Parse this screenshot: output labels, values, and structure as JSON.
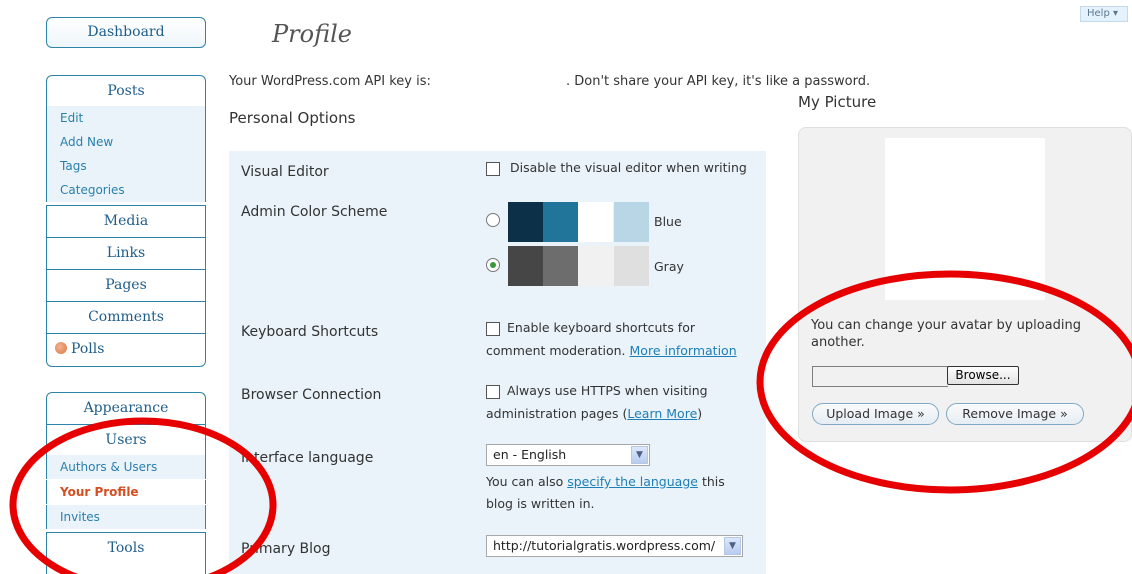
{
  "help_label": "Help",
  "page_title": "Profile",
  "api_key": {
    "prefix": "Your WordPress.com API key is:",
    "suffix": ". Don't share your API key, it's like a password."
  },
  "section_title": "Personal Options",
  "sidebar": {
    "dashboard": "Dashboard",
    "posts": "Posts",
    "posts_sub": [
      "Edit",
      "Add New",
      "Tags",
      "Categories"
    ],
    "media": "Media",
    "links": "Links",
    "pages": "Pages",
    "comments": "Comments",
    "polls": "Polls",
    "appearance": "Appearance",
    "users": "Users",
    "users_sub": [
      "Authors & Users",
      "Your Profile",
      "Invites"
    ],
    "tools": "Tools"
  },
  "options": {
    "visual_editor": {
      "label": "Visual Editor",
      "checkbox": "Disable the visual editor when writing"
    },
    "color_scheme": {
      "label": "Admin Color Scheme",
      "schemes": [
        {
          "name": "Blue",
          "swatches": [
            "#0d3049",
            "#21759b",
            "#ffffff",
            "#b9d6e6"
          ],
          "selected": false
        },
        {
          "name": "Gray",
          "swatches": [
            "#464646",
            "#6d6d6d",
            "#f1f1f1",
            "#dfdfdf"
          ],
          "selected": true
        }
      ]
    },
    "keyboard": {
      "label": "Keyboard Shortcuts",
      "line1": "Enable keyboard shortcuts for",
      "line2": "comment moderation.",
      "link": "More information"
    },
    "browser": {
      "label": "Browser Connection",
      "line1": "Always use HTTPS when visiting",
      "line2": "administration pages (",
      "link": "Learn More",
      "tail": ")"
    },
    "language": {
      "label": "Interface language",
      "value": "en - English",
      "line1": "You can also",
      "link": "specify the language",
      "line1_tail": "this",
      "line2": "blog is written in."
    },
    "primary_blog": {
      "label": "Primary Blog",
      "value": "http://tutorialgratis.wordpress.com/"
    }
  },
  "picture": {
    "title": "My Picture",
    "description": "You can change your avatar by uploading another.",
    "browse_label": "Browse...",
    "upload_label": "Upload Image »",
    "remove_label": "Remove Image »"
  },
  "annotation_color": "#e60000"
}
